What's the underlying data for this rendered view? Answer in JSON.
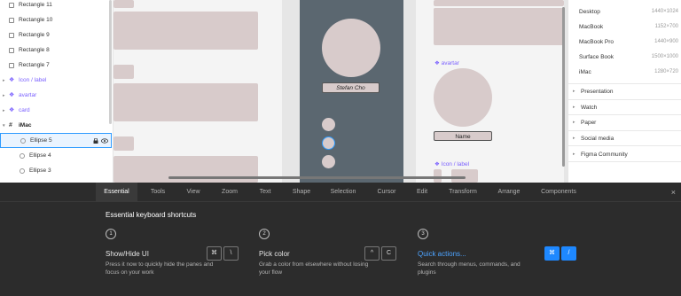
{
  "layers": {
    "items": [
      {
        "label": "Rectangle 11",
        "kind": "rect"
      },
      {
        "label": "Rectangle 10",
        "kind": "rect"
      },
      {
        "label": "Rectangle 9",
        "kind": "rect"
      },
      {
        "label": "Rectangle 8",
        "kind": "rect"
      },
      {
        "label": "Rectangle 7",
        "kind": "rect"
      },
      {
        "label": "Icon / label",
        "kind": "component"
      },
      {
        "label": "avartar",
        "kind": "component"
      },
      {
        "label": "card",
        "kind": "component"
      },
      {
        "label": "iMac",
        "kind": "frame"
      },
      {
        "label": "Ellipse 5",
        "kind": "ellipse",
        "selected": true
      },
      {
        "label": "Ellipse 4",
        "kind": "ellipse"
      },
      {
        "label": "Ellipse 3",
        "kind": "ellipse"
      }
    ]
  },
  "canvas": {
    "name_pill_1": "Stefan Cho",
    "name_pill_2": "Name",
    "component_label_avatar": "avartar",
    "component_label_icon": "Icon / label"
  },
  "right_panel": {
    "devices": [
      {
        "name": "Desktop",
        "size": "1440×1024"
      },
      {
        "name": "MacBook",
        "size": "1152×700"
      },
      {
        "name": "MacBook Pro",
        "size": "1440×900"
      },
      {
        "name": "Surface Book",
        "size": "1500×1000"
      },
      {
        "name": "iMac",
        "size": "1280×720"
      }
    ],
    "categories": [
      "Presentation",
      "Watch",
      "Paper",
      "Social media",
      "Figma Community"
    ]
  },
  "shortcuts": {
    "tabs": [
      "Essential",
      "Tools",
      "View",
      "Zoom",
      "Text",
      "Shape",
      "Selection",
      "Cursor",
      "Edit",
      "Transform",
      "Arrange",
      "Components"
    ],
    "active_tab": "Essential",
    "close_glyph": "×",
    "title": "Essential keyboard shortcuts",
    "items": [
      {
        "num": "1",
        "title": "Show/Hide UI",
        "desc": "Press it now to quickly hide the panes and focus on your work",
        "keys": [
          "⌘",
          "\\"
        ]
      },
      {
        "num": "2",
        "title": "Pick color",
        "desc": "Grab a color from elsewhere without losing your flow",
        "keys": [
          "^",
          "C"
        ]
      },
      {
        "num": "3",
        "title": "Quick actions...",
        "desc": "Search through menus, commands, and plugins",
        "keys": [
          "⌘",
          "/"
        ]
      }
    ]
  },
  "colors": {
    "accent": "#1e88ff",
    "component": "#7b61ff",
    "placeholder": "#d8cbcb",
    "panel_dark": "#2c2c2c"
  }
}
